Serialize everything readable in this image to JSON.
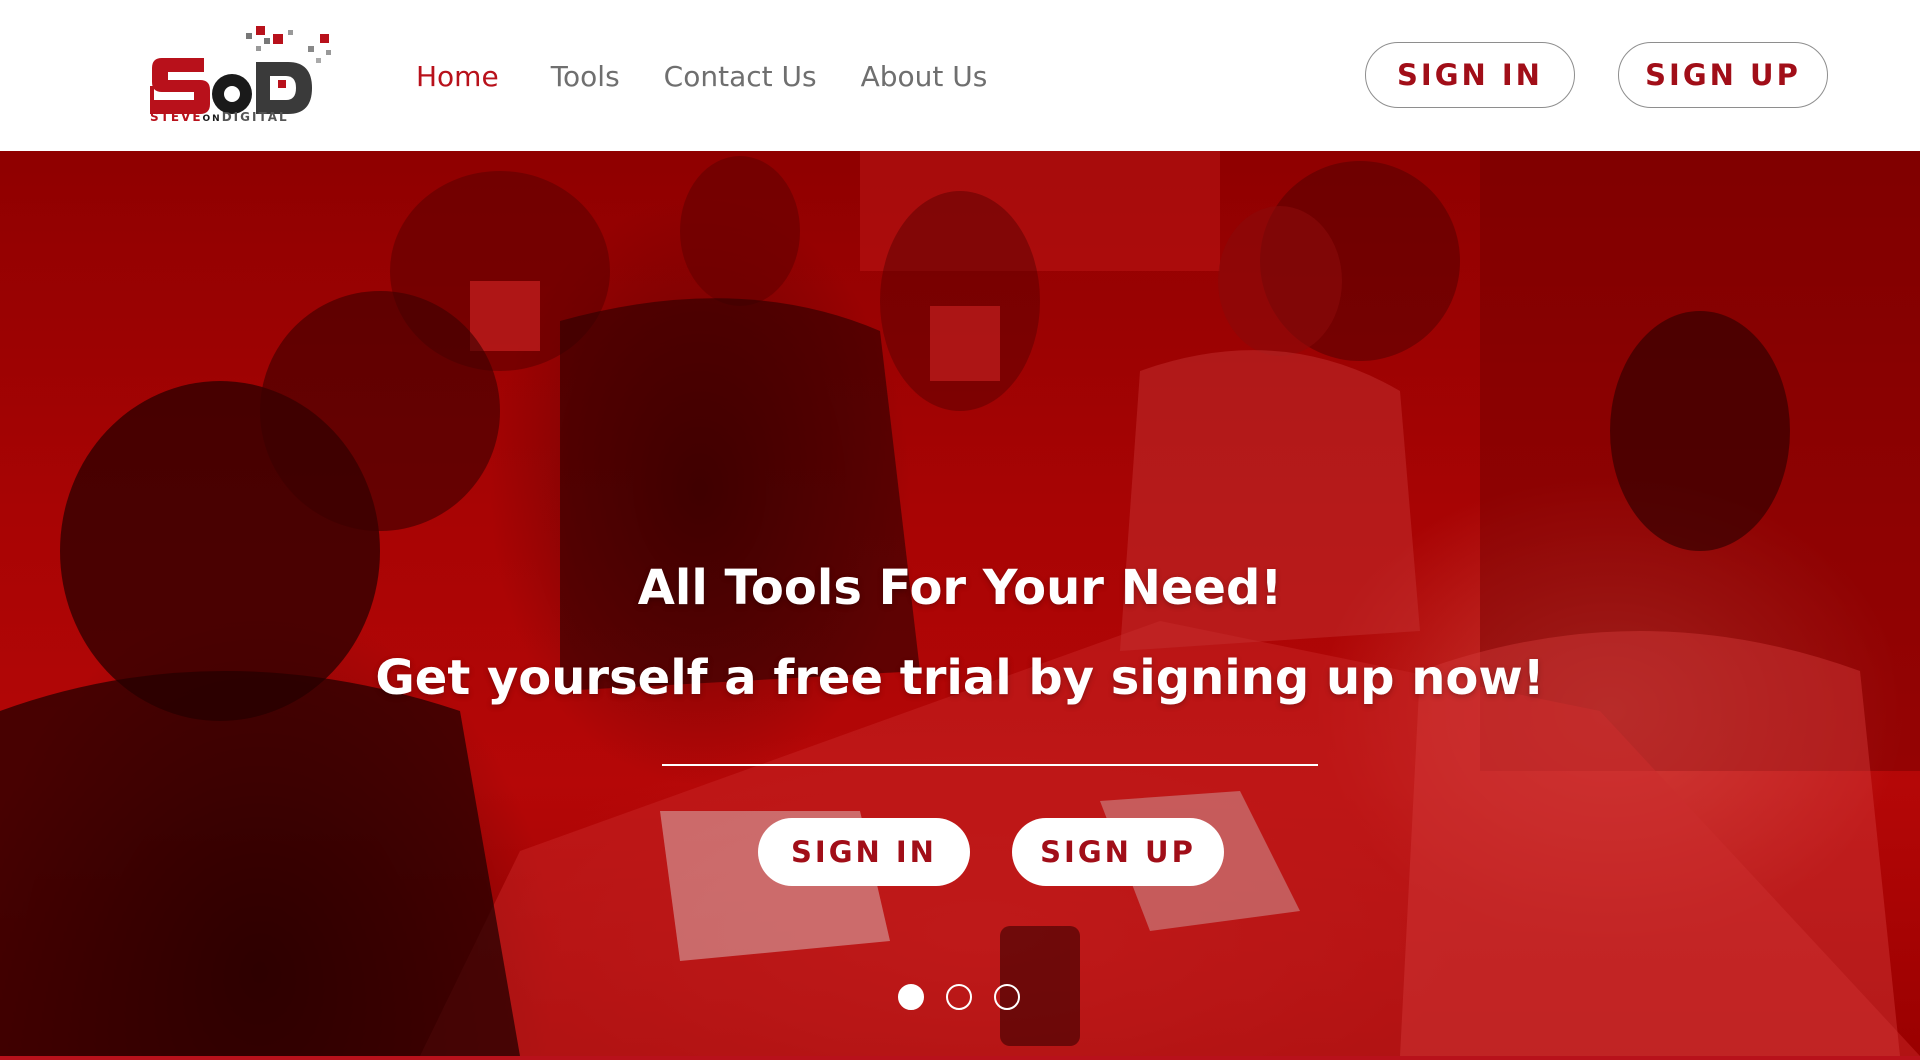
{
  "brand": {
    "logo_letters": "SOD",
    "logo_text_first": "STEVE",
    "logo_text_middle": "ON",
    "logo_text_last": "DIGITAL",
    "primary_color": "#b8111b"
  },
  "nav": {
    "items": [
      {
        "label": "Home",
        "active": true
      },
      {
        "label": "Tools",
        "active": false
      },
      {
        "label": "Contact Us",
        "active": false
      },
      {
        "label": "About Us",
        "active": false
      }
    ]
  },
  "header_actions": {
    "sign_in": "SIGN IN",
    "sign_up": "SIGN UP"
  },
  "hero": {
    "headline": "All Tools For Your Need!",
    "subheadline": "Get yourself a free trial by signing up now!",
    "sign_in": "SIGN IN",
    "sign_up": "SIGN UP",
    "overlay_color": "#b00000",
    "carousel": {
      "slide_count": 3,
      "active_index": 0
    }
  }
}
